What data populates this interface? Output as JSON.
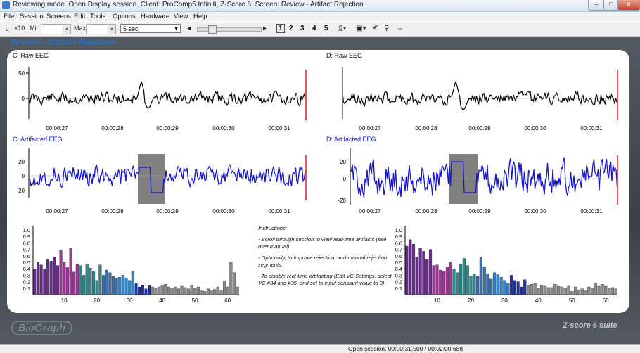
{
  "window": {
    "title": "Reviewing mode. Open Display session. Client: ProComp5 Infiniti, Z-Score 6. Screen: Review - Artifact Rejection",
    "min_glyph": "–",
    "max_glyph": "□",
    "close_glyph": "×"
  },
  "menu": [
    "File",
    "Session",
    "Screens",
    "Edit",
    "Tools",
    "Options",
    "Hardware",
    "View",
    "Help"
  ],
  "toolbar": {
    "zoom_label": "×10",
    "min_label": "Min",
    "max_label": "Max",
    "time_window": "5 sec",
    "screens": [
      "1",
      "2",
      "3",
      "4",
      "5"
    ]
  },
  "screen_name": "Review - Artifact Rejection",
  "left_raw": {
    "title": "C: Raw EEG",
    "yticks": [
      "50",
      "0",
      "-50"
    ],
    "xticks": [
      "00:00:27",
      "00:00:28",
      "00:00:29",
      "00:00:30",
      "00:00:31"
    ]
  },
  "right_raw": {
    "title": "D: Raw EEG",
    "xticks": [
      "00:00:27",
      "00:00:28",
      "00:00:29",
      "00:00:30",
      "00:00:31"
    ]
  },
  "left_art": {
    "title": "C: Artifacted EEG",
    "yticks": [
      "20",
      "0",
      "-20"
    ],
    "xticks": [
      "00:00:27",
      "00:00:28",
      "00:00:29",
      "00:00:30",
      "00:00:31"
    ]
  },
  "right_art": {
    "title": "D: Artifacted EEG",
    "yticks": [
      "20",
      "0",
      "-20"
    ],
    "xticks": [
      "00:00:27",
      "00:00:28",
      "00:00:29",
      "00:00:30",
      "00:00:31"
    ]
  },
  "spec_left": {
    "yticks": [
      "1.0",
      "0.9",
      "0.8",
      "0.7",
      "0.6",
      "0.5",
      "0.4",
      "0.3",
      "0.2",
      "0.1"
    ],
    "xticks": [
      "10",
      "20",
      "30",
      "40",
      "50",
      "60"
    ]
  },
  "spec_right": {
    "yticks": [
      "1.0",
      "0.9",
      "0.8",
      "0.7",
      "0.6",
      "0.5",
      "0.4",
      "0.3",
      "0.2",
      "0.1"
    ],
    "xticks": [
      "10",
      "20",
      "30",
      "40",
      "50",
      "60"
    ]
  },
  "instructions": [
    "Instructions:",
    "- Scroll through session to view real-time artifacts (see user manual).",
    "- Optionally, to improve rejection, add manual rejection segments.",
    "- To disable real-time artifacting (Edit VC Settings, select VC #34 and #35, and set to input constant value to 0)"
  ],
  "branding": {
    "logo": "BioGraph",
    "suite": "Z-score 6 suite"
  },
  "status": "Open session: 00:00:31.500 / 00:02:00.688",
  "colors": {
    "screen_title": "#2a6fc0",
    "artifacted_trace": "#1515d0",
    "raw_trace": "#000000",
    "cursor": "#e02020",
    "rejection_box": "#808080"
  },
  "chart_data": [
    {
      "type": "line",
      "title": "C: Raw EEG",
      "x": [
        "00:00:27",
        "00:00:28",
        "00:00:29",
        "00:00:30",
        "00:00:31"
      ],
      "ylim": [
        -50,
        50
      ],
      "note_visible": "spike near 00:00:28.7"
    },
    {
      "type": "line",
      "title": "D: Raw EEG",
      "x": [
        "00:00:27",
        "00:00:28",
        "00:00:29",
        "00:00:30",
        "00:00:31"
      ]
    },
    {
      "type": "line",
      "title": "C: Artifacted EEG",
      "x": [
        "00:00:27",
        "00:00:28",
        "00:00:29",
        "00:00:30",
        "00:00:31"
      ],
      "ylim": [
        -20,
        20
      ]
    },
    {
      "type": "line",
      "title": "D: Artifacted EEG",
      "x": [
        "00:00:27",
        "00:00:28",
        "00:00:29",
        "00:00:30",
        "00:00:31"
      ],
      "ylim": [
        -20,
        20
      ]
    },
    {
      "type": "bar",
      "x_ticks": [
        10,
        20,
        30,
        40,
        50,
        60
      ],
      "ylim": [
        0,
        1.0
      ],
      "values": [
        0.4,
        0.5,
        0.46,
        0.4,
        0.55,
        0.52,
        0.58,
        0.45,
        0.68,
        0.5,
        0.42,
        0.72,
        0.35,
        0.47,
        0.45,
        0.3,
        0.47,
        0.41,
        0.36,
        0.22,
        0.46,
        0.3,
        0.38,
        0.34,
        0.28,
        0.25,
        0.27,
        0.3,
        0.26,
        0.22,
        0.36,
        0.17,
        0.12,
        0.15,
        0.09,
        0.14,
        0.12,
        0.1,
        0.12,
        0.15,
        0.16,
        0.12,
        0.1,
        0.12,
        0.09,
        0.13,
        0.11,
        0.09,
        0.14,
        0.1,
        0.12,
        0.06,
        0.05,
        0.09,
        0.06,
        0.08,
        0.12,
        0.06,
        0.21,
        0.12,
        0.5,
        0.34,
        0.12
      ]
    },
    {
      "type": "bar",
      "x_ticks": [
        10,
        20,
        30,
        40,
        50,
        60
      ],
      "ylim": [
        0,
        1.0
      ],
      "values": [
        0.75,
        0.85,
        0.78,
        0.58,
        0.72,
        0.67,
        0.55,
        0.7,
        0.45,
        0.46,
        0.38,
        0.36,
        0.43,
        0.5,
        0.4,
        0.34,
        0.47,
        0.56,
        0.45,
        0.28,
        0.32,
        0.28,
        0.58,
        0.43,
        0.32,
        0.24,
        0.34,
        0.31,
        0.27,
        0.22,
        0.18,
        0.3,
        0.22,
        0.2,
        0.12,
        0.23,
        0.14,
        0.16,
        0.17,
        0.1,
        0.14,
        0.13,
        0.11,
        0.11,
        0.16,
        0.13,
        0.12,
        0.1,
        0.13,
        0.05,
        0.12,
        0.07,
        0.09,
        0.06,
        0.12,
        0.1,
        0.17,
        0.13,
        0.16,
        0.13,
        0.1,
        0.11,
        0.09
      ]
    }
  ]
}
